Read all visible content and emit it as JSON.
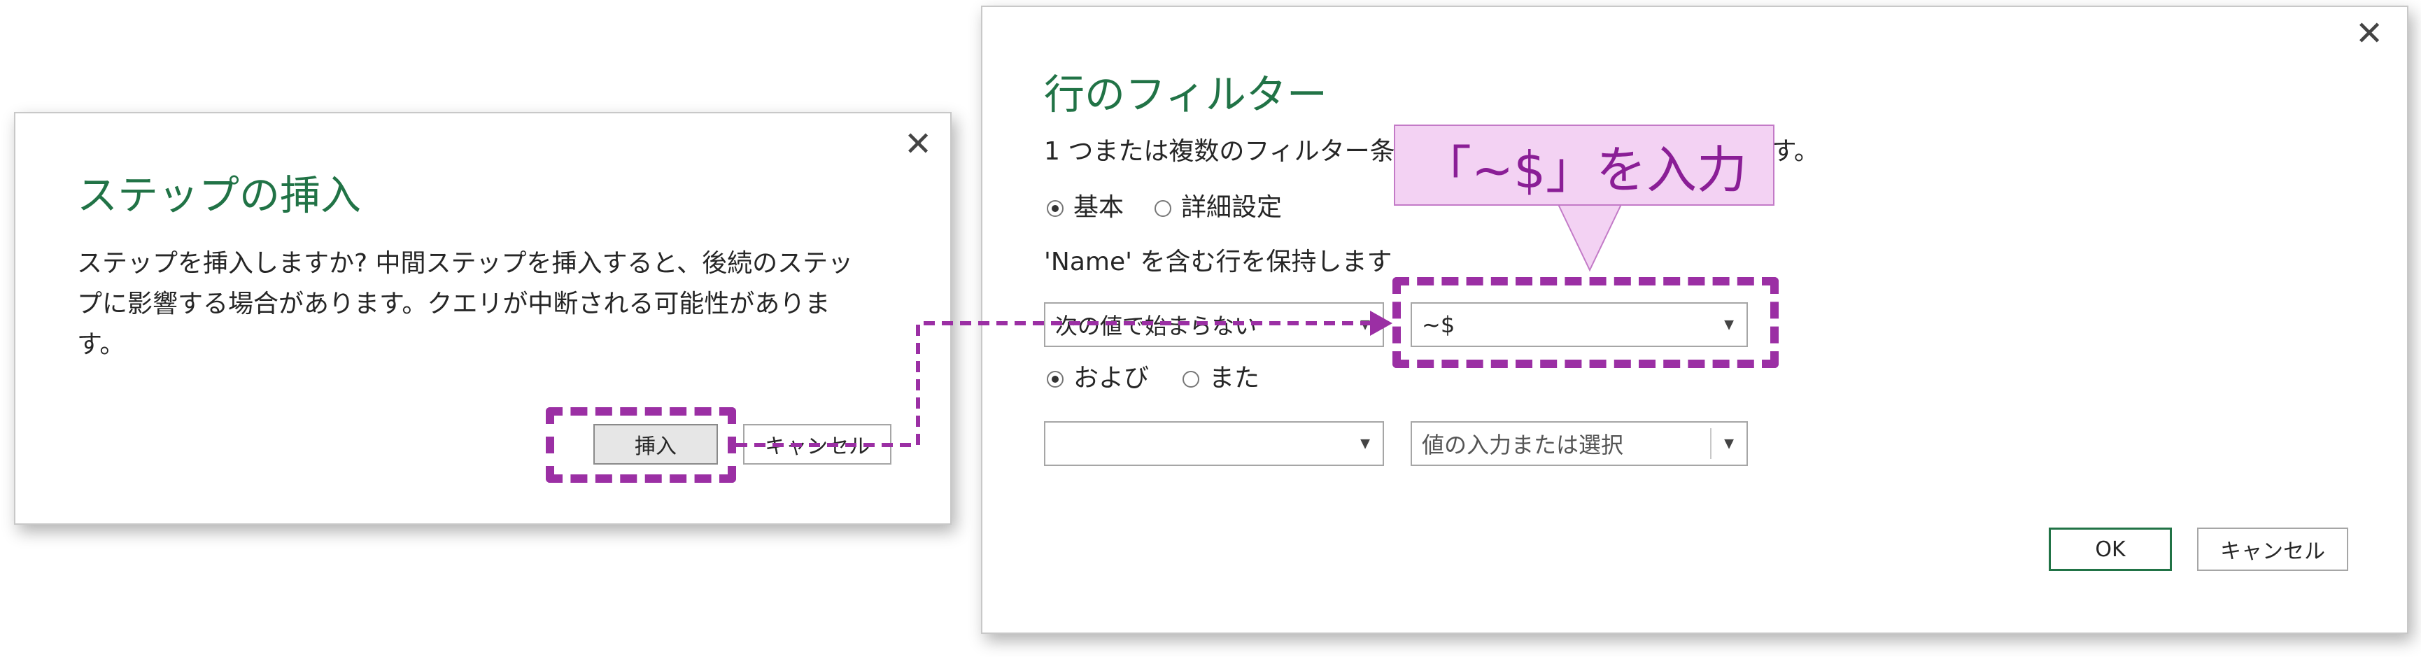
{
  "insert_dialog": {
    "title": "ステップの挿入",
    "message_lines": [
      "ステップを挿入しますか? 中間ステップを挿入すると、後続のステッ",
      "プに影響する場合があります。クエリが中断される可能性がありま",
      "す。"
    ],
    "insert_label": "挿入",
    "cancel_label": "キャンセル",
    "close_glyph": "✕"
  },
  "filter_dialog": {
    "title": "行のフィルター",
    "description": "1 つまたは複数のフィルター条件をこのテーブルの行に適用します。",
    "mode_basic": "基本",
    "mode_advanced": "詳細設定",
    "condition_label": "'Name' を含む行を保持します",
    "rule1_operator": "次の値で始まらない",
    "rule1_value": "~$",
    "and_label": "および",
    "or_label": "また",
    "rule2_operator": "",
    "rule2_value_placeholder": "値の入力または選択",
    "ok_label": "OK",
    "cancel_label": "キャンセル",
    "close_glyph": "✕"
  },
  "annotation": {
    "callout_text": "「~$」を入力",
    "highlight_color": "#9b2fa4"
  },
  "colors": {
    "title_green": "#217346",
    "callout_bg": "#f3d2f3",
    "callout_text": "#8a1e96"
  }
}
